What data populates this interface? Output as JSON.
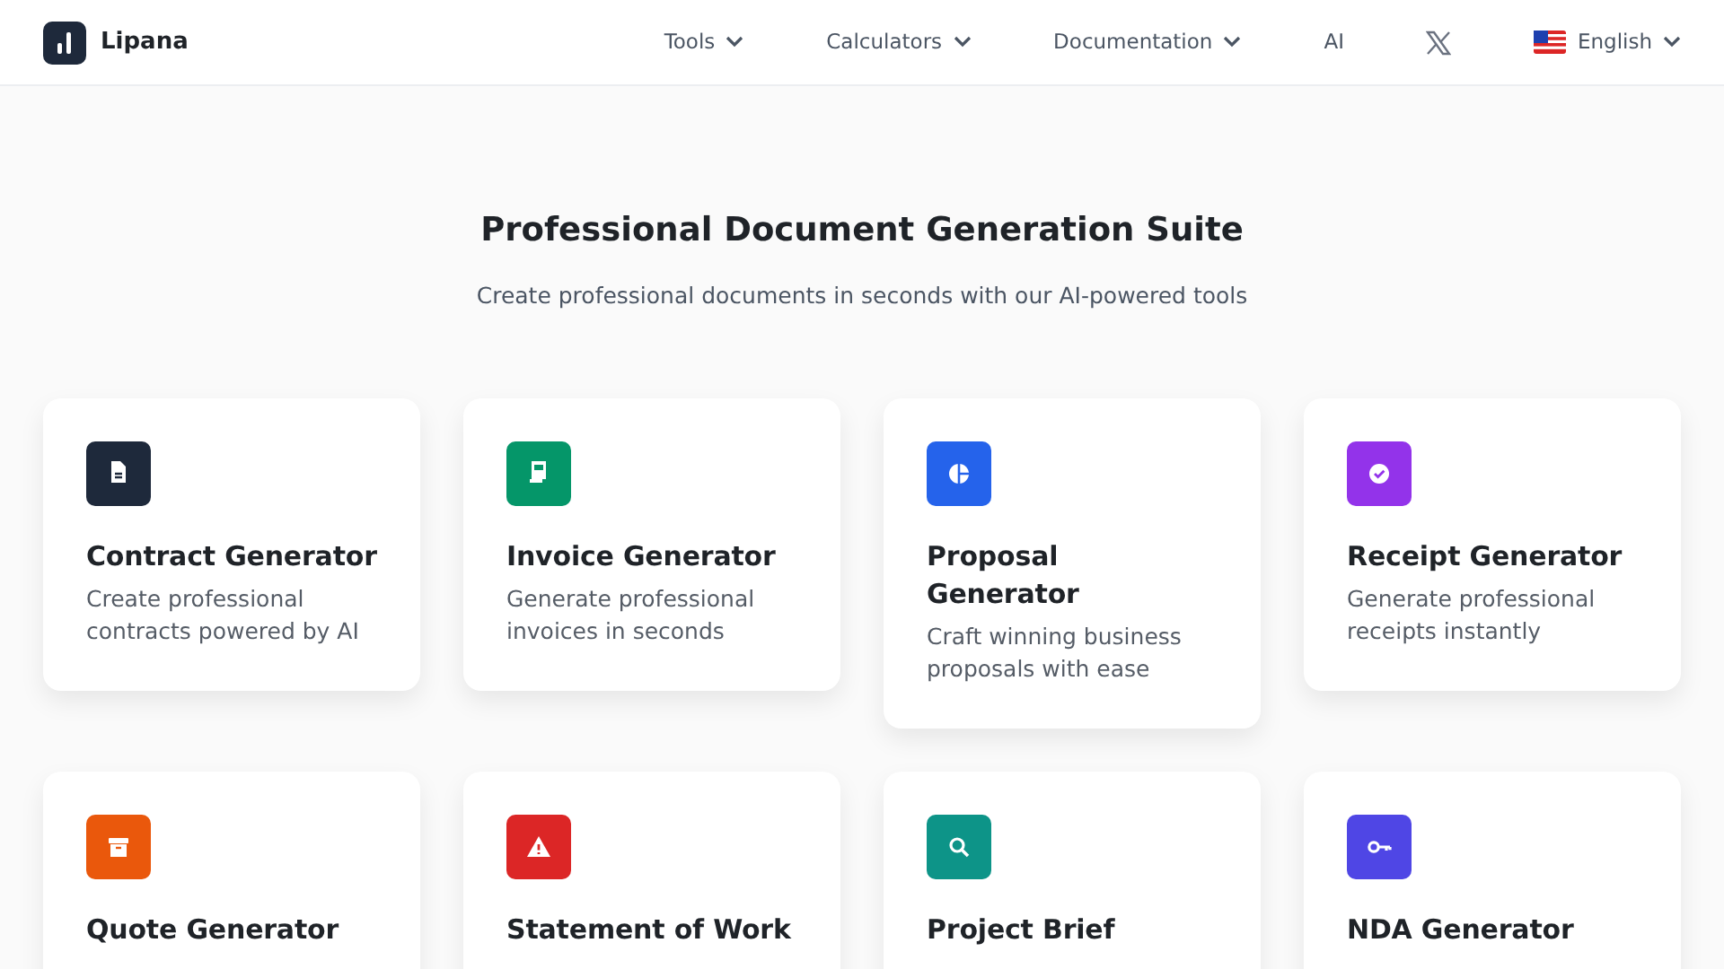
{
  "brand": {
    "name": "Lipana"
  },
  "nav": [
    {
      "label": "Tools",
      "dropdown": true
    },
    {
      "label": "Calculators",
      "dropdown": true
    },
    {
      "label": "Documentation",
      "dropdown": true
    },
    {
      "label": "AI",
      "dropdown": false
    }
  ],
  "language": {
    "label": "English"
  },
  "hero": {
    "title": "Professional Document Generation Suite",
    "subtitle": "Create professional documents in seconds with our AI-powered tools"
  },
  "cards": [
    {
      "kind": "document",
      "color": "#1e293b",
      "title": "Contract Generator",
      "description": "Create professional contracts powered by AI"
    },
    {
      "kind": "invoice",
      "color": "#059669",
      "title": "Invoice Generator",
      "description": "Generate professional invoices in seconds"
    },
    {
      "kind": "chart",
      "color": "#2563eb",
      "title": "Proposal Generator",
      "description": "Craft winning business proposals with ease"
    },
    {
      "kind": "check",
      "color": "#9333ea",
      "title": "Receipt Generator",
      "description": "Generate professional receipts instantly"
    },
    {
      "kind": "archive",
      "color": "#ea580c",
      "title": "Quote Generator"
    },
    {
      "kind": "warning",
      "color": "#dc2626",
      "title": "Statement of Work"
    },
    {
      "kind": "search",
      "color": "#0d9488",
      "title": "Project Brief"
    },
    {
      "kind": "key",
      "color": "#4f46e5",
      "title": "NDA Generator"
    }
  ]
}
